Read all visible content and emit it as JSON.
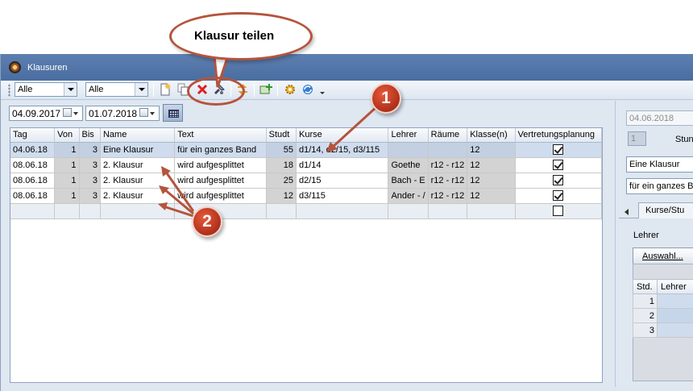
{
  "window": {
    "title": "Klausuren"
  },
  "toolbar": {
    "filter1": "Alle",
    "filter2": "Alle"
  },
  "dates": {
    "from": "04.09.2017",
    "to": "01.07.2018"
  },
  "table": {
    "headers": [
      "Tag",
      "Von",
      "Bis",
      "Name",
      "Text",
      "Studt",
      "Kurse",
      "Lehrer",
      "Räume",
      "Klasse(n)",
      "Vertretungsplanung"
    ],
    "rows": [
      {
        "tag": "04.06.18",
        "von": "1",
        "bis": "3",
        "name": "Eine Klausur",
        "text": "für ein ganzes Band",
        "studt": "55",
        "kurse": "d1/14, d2/15, d3/115",
        "lehrer": "",
        "raeume": "",
        "klassen": "12",
        "vertretung": true
      },
      {
        "tag": "08.06.18",
        "von": "1",
        "bis": "3",
        "name": "2. Klausur",
        "text": "wird aufgesplittet",
        "studt": "18",
        "kurse": "d1/14",
        "lehrer": "Goethe",
        "raeume": "r12 - r12",
        "klassen": "12",
        "vertretung": true
      },
      {
        "tag": "08.06.18",
        "von": "1",
        "bis": "3",
        "name": "2. Klausur",
        "text": "wird aufgesplittet",
        "studt": "25",
        "kurse": "d2/15",
        "lehrer": "Bach - E",
        "raeume": "r12 - r12",
        "klassen": "12",
        "vertretung": true
      },
      {
        "tag": "08.06.18",
        "von": "1",
        "bis": "3",
        "name": "2. Klausur",
        "text": "wird aufgesplittet",
        "studt": "12",
        "kurse": "d3/115",
        "lehrer": "Ander - /",
        "raeume": "r12 - r12",
        "klassen": "12",
        "vertretung": true
      }
    ]
  },
  "details": {
    "date": "04.06.2018",
    "spin_value": "1",
    "stunden_label": "Stunde",
    "name_value": "Eine Klausur",
    "text_value": "für ein ganzes Ba",
    "tab_label": "Kurse/Stu",
    "lehrer_label": "Lehrer",
    "auswahl_button": "Auswahl...",
    "sub_headers": [
      "Std.",
      "Lehrer"
    ],
    "sub_rows": [
      "1",
      "2",
      "3"
    ]
  },
  "callout": {
    "text": "Klausur teilen",
    "badge1": "1",
    "badge2": "2",
    "accent": "#b5543c"
  },
  "icons": [
    "new-icon",
    "copy-icon",
    "delete-icon",
    "split-icon",
    "transfer-icon",
    "add-icon",
    "settings-icon",
    "refresh-icon"
  ]
}
